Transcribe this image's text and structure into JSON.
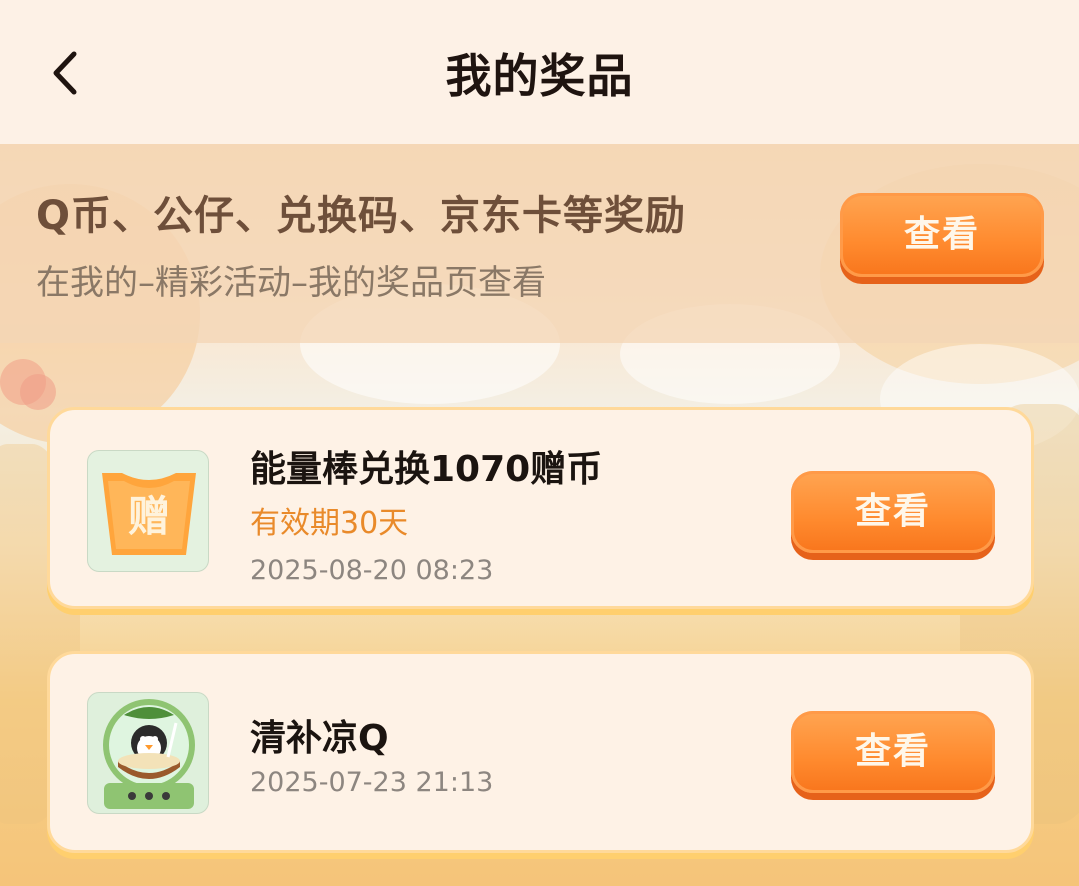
{
  "header": {
    "title": "我的奖品",
    "back_icon": "chevron-left-icon"
  },
  "banner": {
    "title": "Q币、公仔、兑换码、京东卡等奖励",
    "subtitle": "在我的–精彩活动–我的奖品页查看",
    "button_label": "查看"
  },
  "prizes": [
    {
      "name": "能量棒兑换1070赠币",
      "validity": "有效期30天",
      "date": "2025-08-20 08:23",
      "button_label": "查看",
      "icon": "gift-ticket-icon",
      "icon_text": "赠"
    },
    {
      "name": "清补凉Q",
      "date": "2025-07-23 21:13",
      "button_label": "查看",
      "icon": "penguin-coconut-drink-icon"
    }
  ],
  "colors": {
    "accent": "#ff8a2e",
    "validity_text": "#e98a2a",
    "card_border": "#ffd99a"
  }
}
